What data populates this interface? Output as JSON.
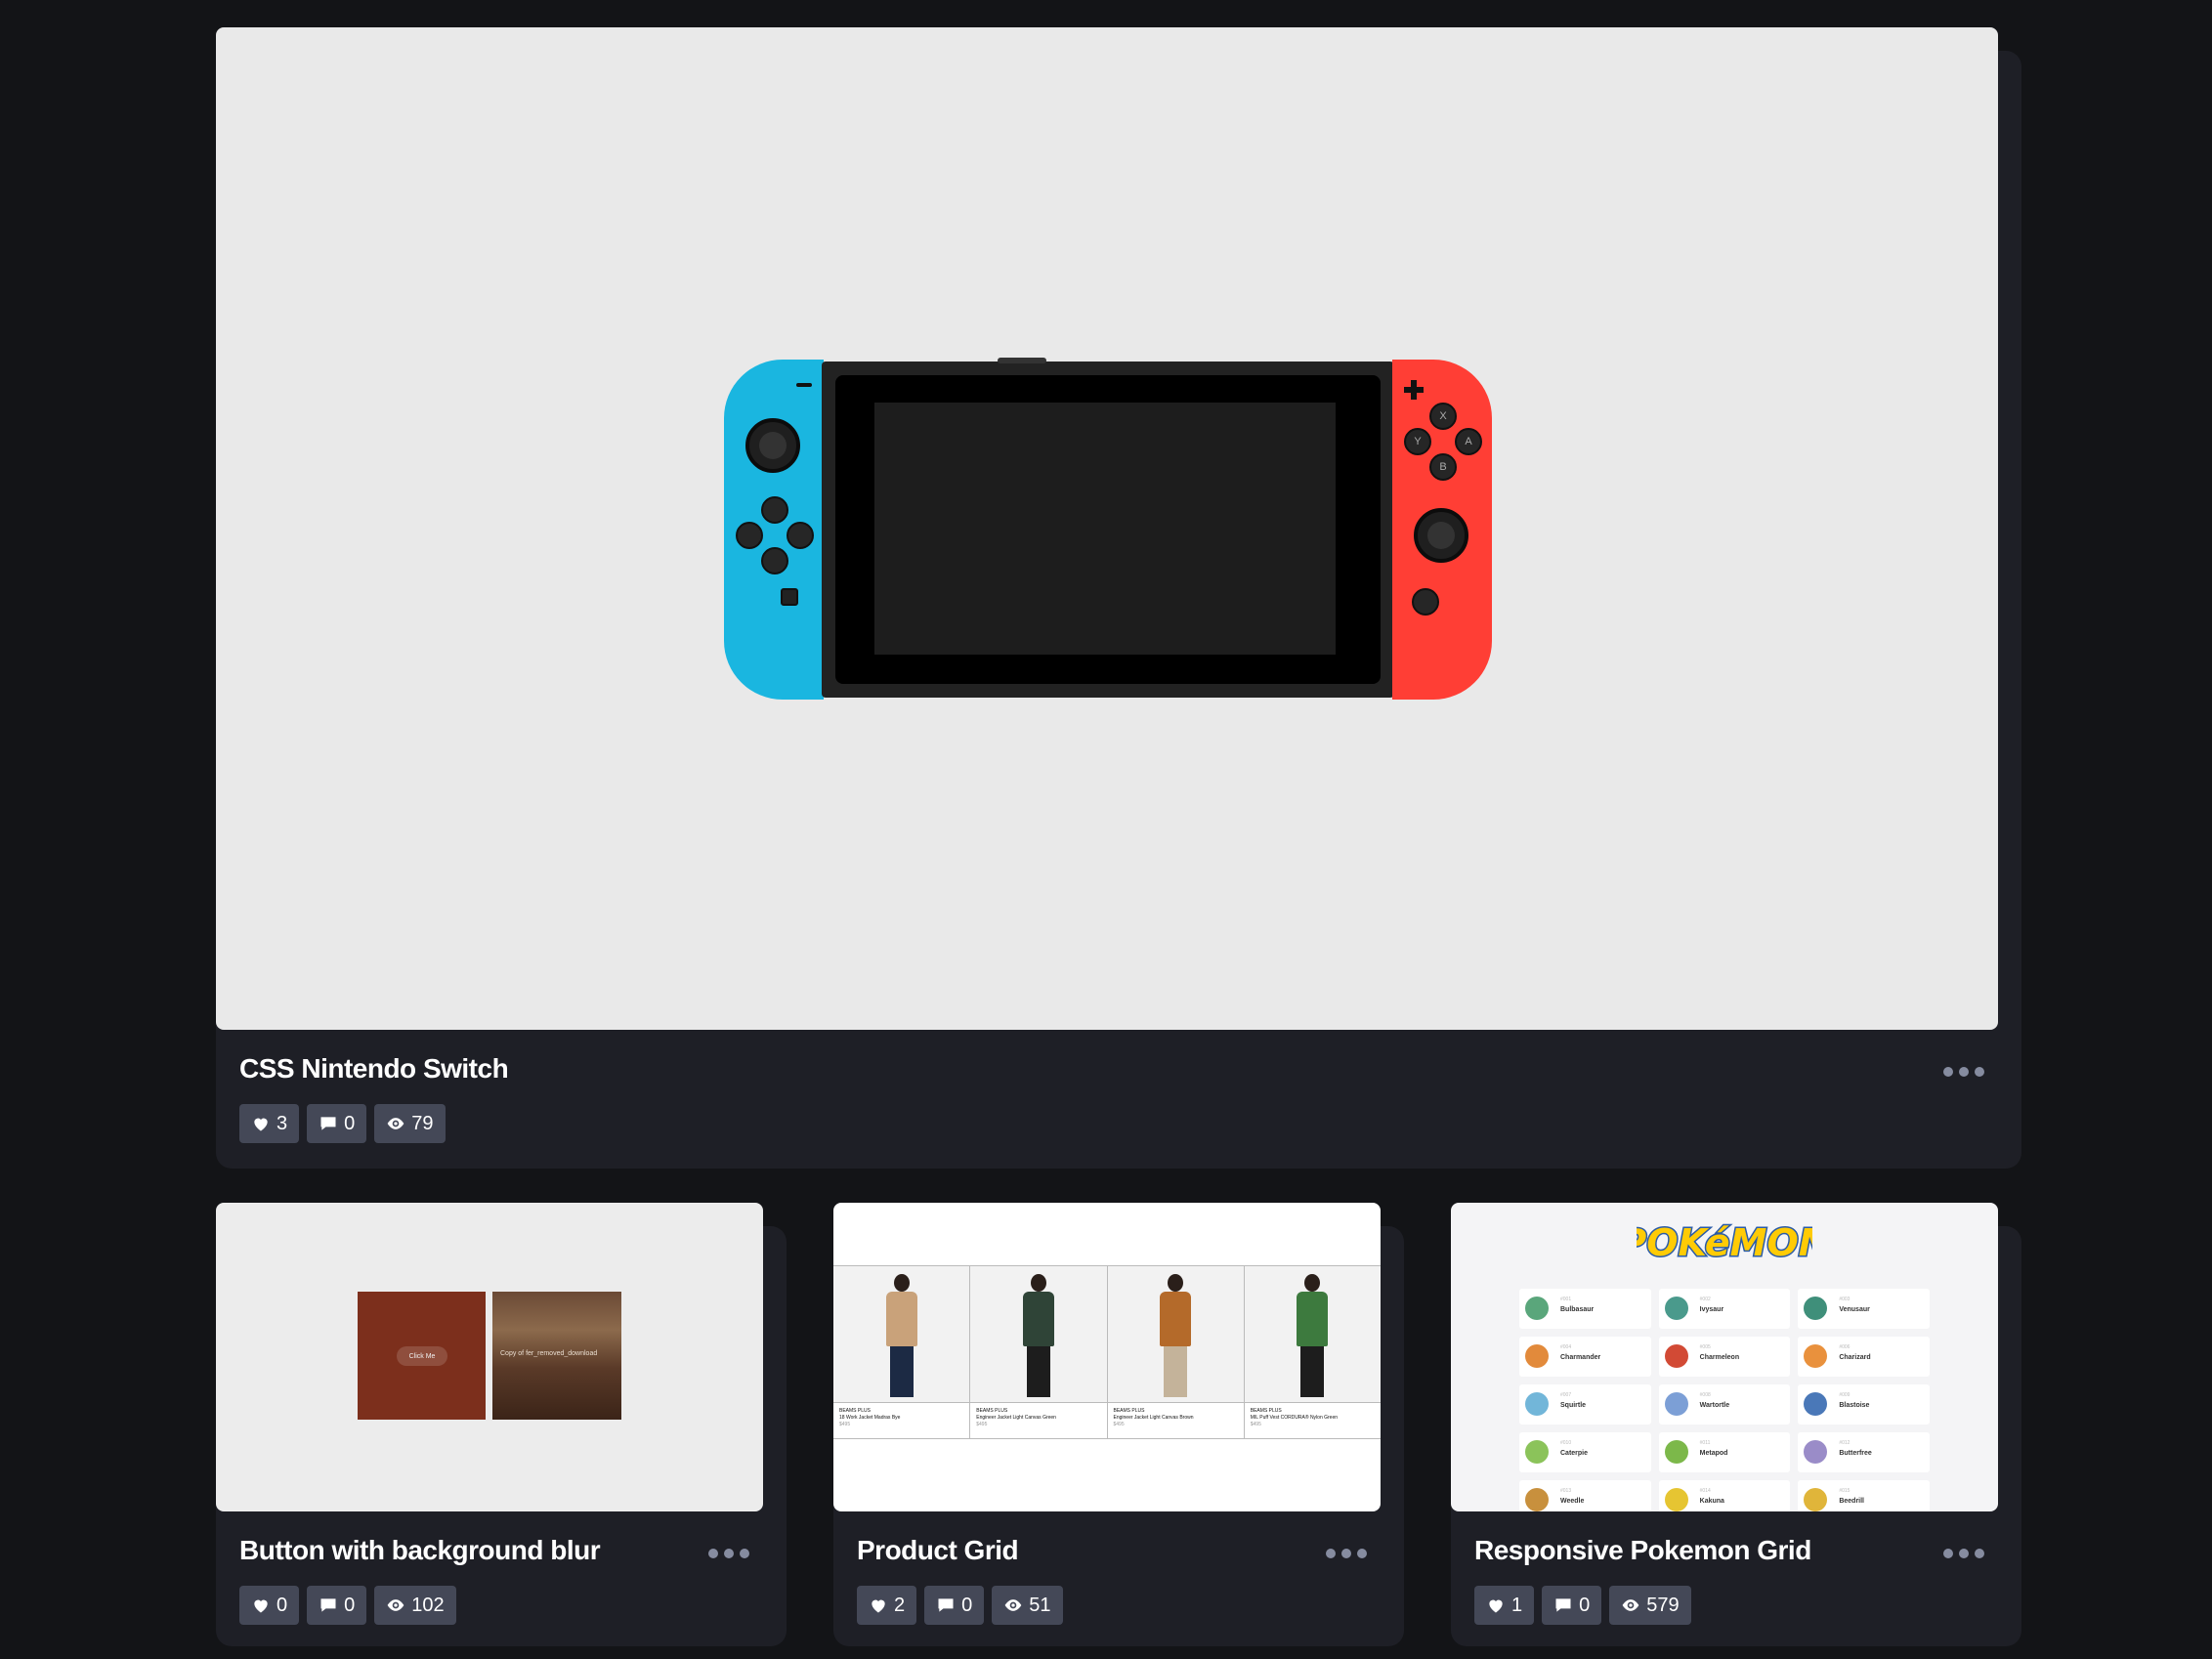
{
  "cards": [
    {
      "title": "CSS Nintendo Switch",
      "likes": "3",
      "comments": "0",
      "views": "79",
      "preview": {
        "buttons": {
          "x": "X",
          "y": "Y",
          "a": "A",
          "b": "B"
        },
        "colors": {
          "left_joycon": "#1ab6e0",
          "right_joycon": "#ff3e35",
          "background": "#e9e9e9"
        }
      }
    },
    {
      "title": "Button with background blur",
      "likes": "0",
      "comments": "0",
      "views": "102",
      "preview": {
        "button_label": "Click Me",
        "image_caption": "Copy of fer_removed_download"
      }
    },
    {
      "title": "Product Grid",
      "likes": "2",
      "comments": "0",
      "views": "51",
      "preview": {
        "products": [
          {
            "brand": "BEAMS PLUS",
            "name": "18 Work Jacket Madras Bye",
            "price": "$495",
            "color": "#c9a27a",
            "legs": "#1c2a44"
          },
          {
            "brand": "BEAMS PLUS",
            "name": "Engineer Jacket Light Canvas Green",
            "price": "$495",
            "color": "#2f4437",
            "legs": "#1d1d1d"
          },
          {
            "brand": "BEAMS PLUS",
            "name": "Engineer Jacket Light Canvas Brown",
            "price": "$495",
            "color": "#b46a2a",
            "legs": "#c4b39a"
          },
          {
            "brand": "BEAMS PLUS",
            "name": "MIL Puff Vest CORDURA® Nylon Green",
            "price": "$495",
            "color": "#3d7a3e",
            "legs": "#1d1d1d"
          }
        ]
      }
    },
    {
      "title": "Responsive Pokemon Grid",
      "likes": "1",
      "comments": "0",
      "views": "579",
      "preview": {
        "logo_text": "POKéMON",
        "pokemon": [
          {
            "num": "#001",
            "name": "Bulbasaur",
            "color": "#5aa67b"
          },
          {
            "num": "#002",
            "name": "Ivysaur",
            "color": "#4a9a8c"
          },
          {
            "num": "#003",
            "name": "Venusaur",
            "color": "#3f8f7a"
          },
          {
            "num": "#004",
            "name": "Charmander",
            "color": "#e28a3b"
          },
          {
            "num": "#005",
            "name": "Charmeleon",
            "color": "#d24a35"
          },
          {
            "num": "#006",
            "name": "Charizard",
            "color": "#e9913d"
          },
          {
            "num": "#007",
            "name": "Squirtle",
            "color": "#72b6d9"
          },
          {
            "num": "#008",
            "name": "Wartortle",
            "color": "#7c9fd6"
          },
          {
            "num": "#009",
            "name": "Blastoise",
            "color": "#4a78b8"
          },
          {
            "num": "#010",
            "name": "Caterpie",
            "color": "#8bc35a"
          },
          {
            "num": "#011",
            "name": "Metapod",
            "color": "#7cb84a"
          },
          {
            "num": "#012",
            "name": "Butterfree",
            "color": "#9a8cc8"
          },
          {
            "num": "#013",
            "name": "Weedle",
            "color": "#c8903d"
          },
          {
            "num": "#014",
            "name": "Kakuna",
            "color": "#e6c532"
          },
          {
            "num": "#015",
            "name": "Beedrill",
            "color": "#e0b53a"
          }
        ]
      }
    }
  ],
  "ui": {
    "more_icon": "more-horizontal-icon",
    "like_icon": "heart-icon",
    "comment_icon": "comment-icon",
    "view_icon": "eye-icon"
  }
}
